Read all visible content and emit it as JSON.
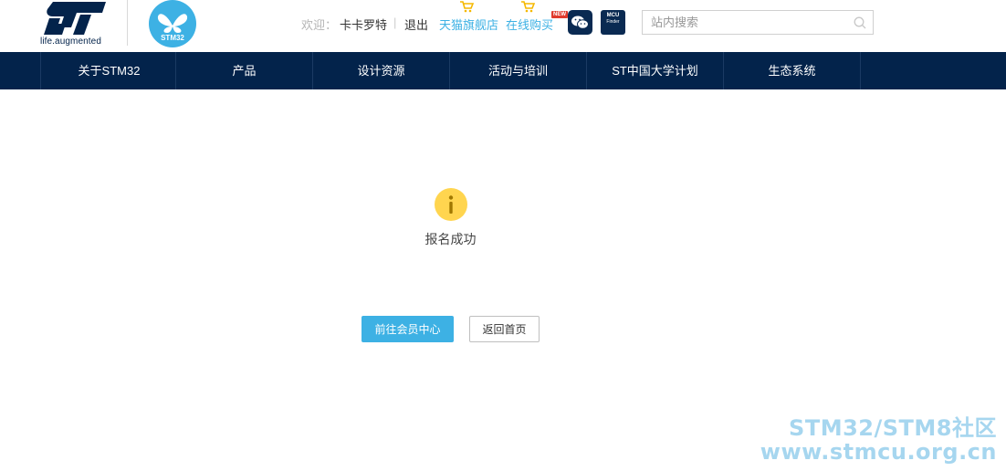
{
  "brand": {
    "tagline": "life.augmented",
    "product_logo_text": "STM32"
  },
  "topbar": {
    "welcome_label": "欢迎：",
    "username": "卡卡罗特",
    "separator": "|",
    "logout": "退出",
    "tmall_store": "天猫旗舰店",
    "online_shop": "在线购买",
    "new_badge": "NEW",
    "wechat_icon": "wechat-icon",
    "mcu_finder": {
      "line1": "MCU",
      "line2": "Finder"
    },
    "search": {
      "placeholder": "站内搜索",
      "value": ""
    }
  },
  "nav": {
    "items": [
      {
        "label": "关于STM32"
      },
      {
        "label": "产品"
      },
      {
        "label": "设计资源"
      },
      {
        "label": "活动与培训"
      },
      {
        "label": "ST中国大学计划"
      },
      {
        "label": "生态系统"
      }
    ]
  },
  "main": {
    "status_icon": "info-icon",
    "message": "报名成功",
    "primary_button": "前往会员中心",
    "secondary_button": "返回首页"
  },
  "watermark": {
    "line1": "STM32/STM8社区",
    "line2": "www.stmcu.org.cn"
  },
  "colors": {
    "nav_bg": "#03234b",
    "accent": "#3db1e4",
    "info_yellow": "#ffd54f",
    "watermark": "#a6d6ef"
  }
}
